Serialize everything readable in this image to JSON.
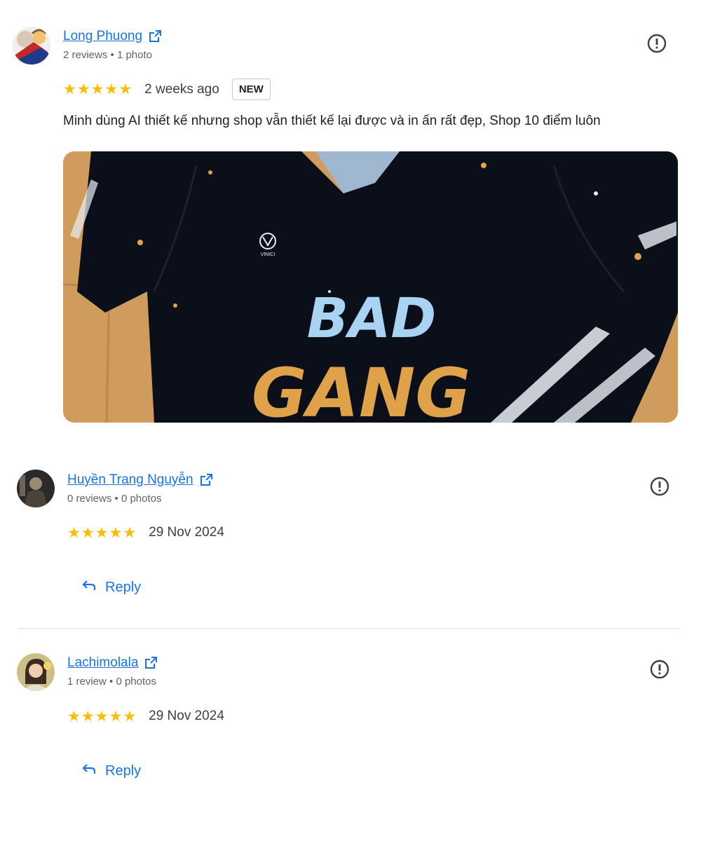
{
  "reviews": [
    {
      "author": "Long Phuong",
      "meta": "2 reviews • 1 photo",
      "rating": 5,
      "date": "2 weeks ago",
      "badge": "NEW",
      "text": "Minh dùng AI thiết kế nhưng shop vẫn thiết kế lại được và in ấn rất đẹp, Shop 10 điểm luôn",
      "photo": {
        "logo_text": "VINICI",
        "graphic_line1": "BAD",
        "graphic_line2": "GANG"
      }
    },
    {
      "author": "Huyền Trang Nguyễn",
      "meta": "0 reviews • 0 photos",
      "rating": 5,
      "date": "29 Nov 2024",
      "reply_label": "Reply"
    },
    {
      "author": "Lachimolala",
      "meta": "1 review • 0 photos",
      "rating": 5,
      "date": "29 Nov 2024",
      "reply_label": "Reply"
    }
  ],
  "icons": {
    "external_link": "external-link-icon",
    "report": "flag-report-icon",
    "reply": "reply-arrow-icon",
    "star": "star-icon"
  },
  "colors": {
    "link": "#1a73e8",
    "star": "#fbbc04",
    "shirt": "#0b0f1a",
    "graphic_blue": "#a9d3f2",
    "graphic_orange": "#e0a248"
  }
}
